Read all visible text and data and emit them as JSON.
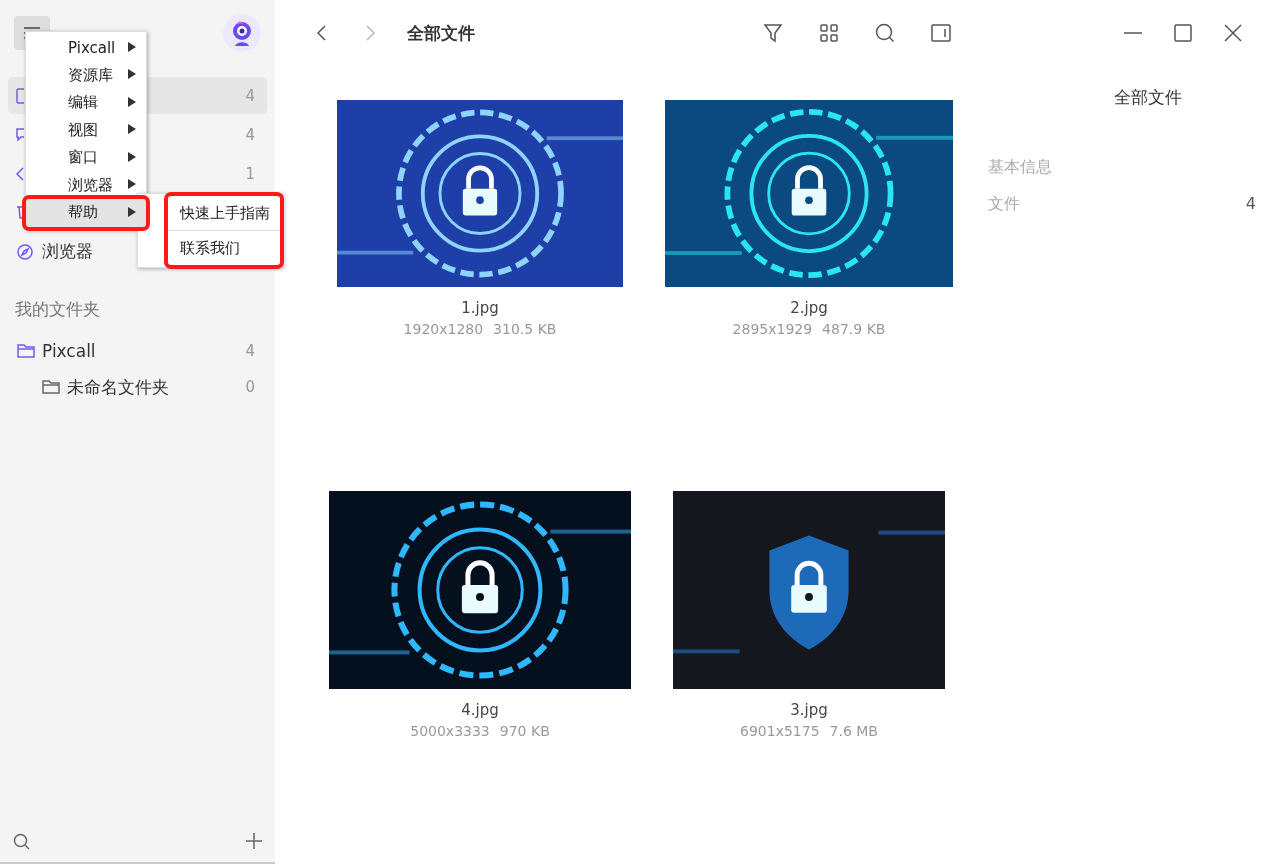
{
  "sidebar": {
    "nav": [
      {
        "count": "4",
        "selected": true
      },
      {
        "count": "4",
        "selected": false
      },
      {
        "count": "1",
        "selected": false
      },
      {
        "selected": false
      },
      {
        "label": "浏览器",
        "selected": false
      }
    ],
    "folders_heading": "我的文件夹",
    "folders": [
      {
        "name": "Pixcall",
        "count": "4",
        "children": [
          {
            "name": "未命名文件夹",
            "count": "0"
          }
        ]
      }
    ]
  },
  "menu": {
    "items": [
      {
        "label": "Pixcall",
        "selected": false,
        "highlighted": false
      },
      {
        "label": "资源库",
        "selected": false,
        "highlighted": false
      },
      {
        "label": "编辑",
        "selected": false,
        "highlighted": false
      },
      {
        "label": "视图",
        "selected": false,
        "highlighted": false
      },
      {
        "label": "窗口",
        "selected": false,
        "highlighted": false
      },
      {
        "label": "浏览器",
        "selected": false,
        "highlighted": false
      },
      {
        "label": "帮助",
        "selected": true,
        "highlighted": true
      }
    ],
    "submenu": {
      "highlighted": true,
      "items": [
        "快速上手指南",
        "联系我们"
      ]
    }
  },
  "toolbar": {
    "title": "全部文件"
  },
  "files": [
    {
      "name": "1.jpg",
      "size": "1920x1280",
      "bytes": "310.5 KB"
    },
    {
      "name": "2.jpg",
      "size": "2895x1929",
      "bytes": "487.9 KB"
    },
    {
      "name": "4.jpg",
      "size": "5000x3333",
      "bytes": "970 KB"
    },
    {
      "name": "3.jpg",
      "size": "6901x5175",
      "bytes": "7.6 MB"
    }
  ],
  "info": {
    "title": "全部文件",
    "section": "基本信息",
    "rows": [
      {
        "label": "文件",
        "value": "4"
      }
    ]
  }
}
